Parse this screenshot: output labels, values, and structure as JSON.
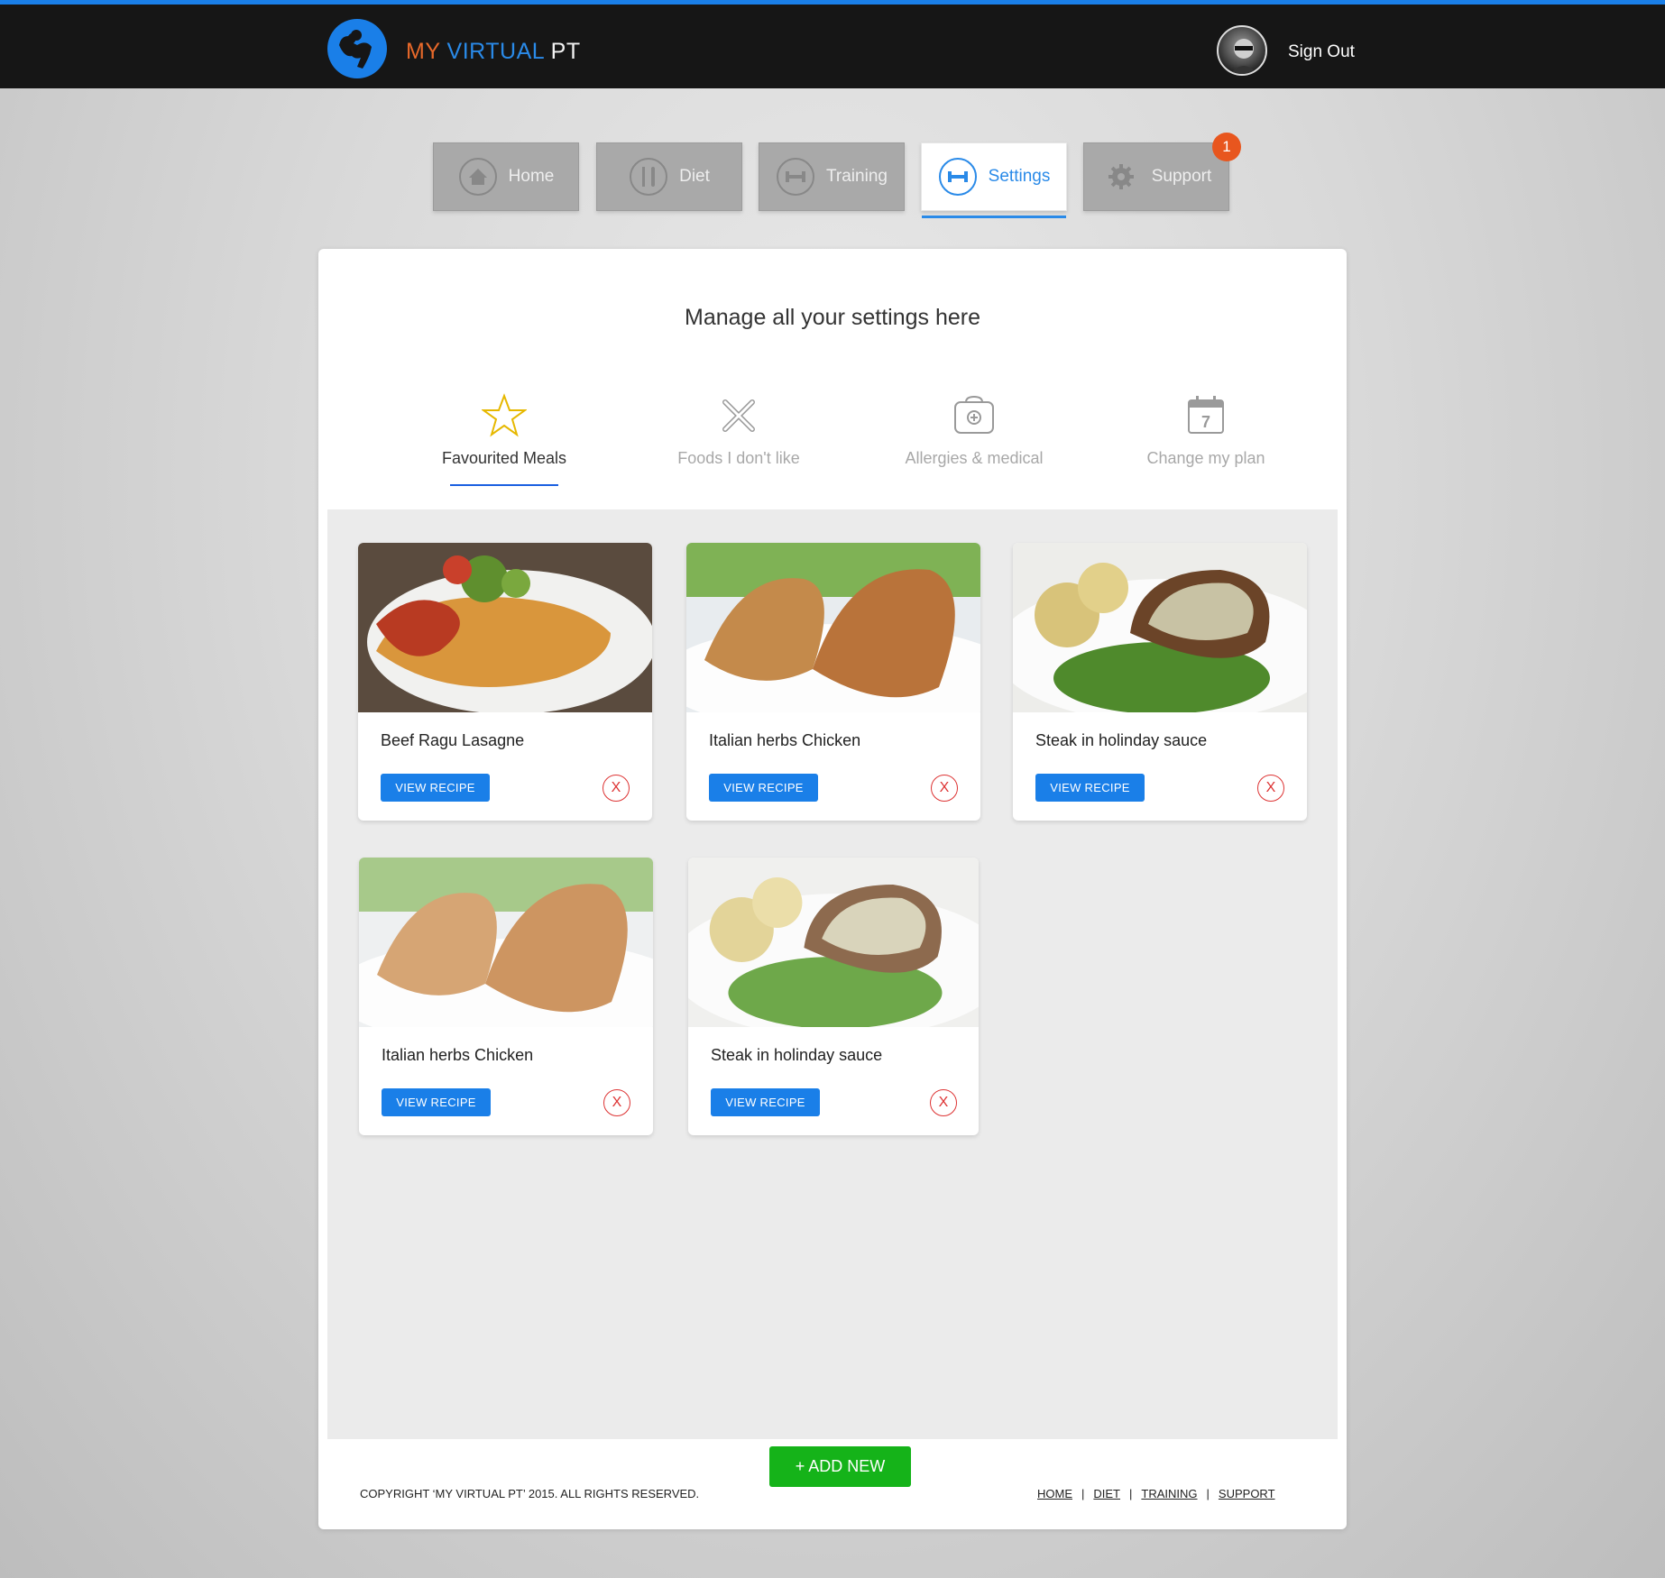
{
  "header": {
    "brand_part1": "MY",
    "brand_part2": "VIRTUAL",
    "brand_part3": "PT",
    "sign_out": "Sign Out"
  },
  "nav": {
    "tabs": [
      {
        "label": "Home",
        "icon": "home-icon"
      },
      {
        "label": "Diet",
        "icon": "fork-knife-icon"
      },
      {
        "label": "Training",
        "icon": "dumbbell-icon"
      },
      {
        "label": "Settings",
        "icon": "dumbbell-icon",
        "active": true
      },
      {
        "label": "Support",
        "icon": "gear-icon"
      }
    ],
    "support_badge": "1"
  },
  "main": {
    "title": "Manage all your settings here",
    "subtabs": [
      {
        "label": "Favourited Meals",
        "icon": "star-icon",
        "active": true
      },
      {
        "label": "Foods I don't like",
        "icon": "cross-icon"
      },
      {
        "label": "Allergies & medical",
        "icon": "medical-kit-icon"
      },
      {
        "label": "Change my plan",
        "icon": "calendar-icon"
      }
    ],
    "meals": [
      {
        "name": "Beef Ragu Lasagne",
        "button": "VIEW RECIPE",
        "remove": "X"
      },
      {
        "name": "Italian herbs Chicken",
        "button": "VIEW RECIPE",
        "remove": "X"
      },
      {
        "name": "Steak in holinday sauce",
        "button": "VIEW RECIPE",
        "remove": "X"
      },
      {
        "name": "Italian herbs Chicken",
        "button": "VIEW RECIPE",
        "remove": "X"
      },
      {
        "name": "Steak in holinday sauce",
        "button": "VIEW RECIPE",
        "remove": "X"
      }
    ],
    "add_new": "+ ADD NEW"
  },
  "footer": {
    "copyright": "COPYRIGHT ‘MY VIRTUAL PT’ 2015. ALL RIGHTS RESERVED.",
    "links": [
      "HOME",
      "DIET",
      "TRAINING",
      "SUPPORT"
    ],
    "separator": "|"
  },
  "colors": {
    "accent": "#1a7fe8",
    "brand_orange": "#e8692a",
    "add_green": "#15b319",
    "remove_red": "#d33333",
    "badge": "#e8561e"
  }
}
